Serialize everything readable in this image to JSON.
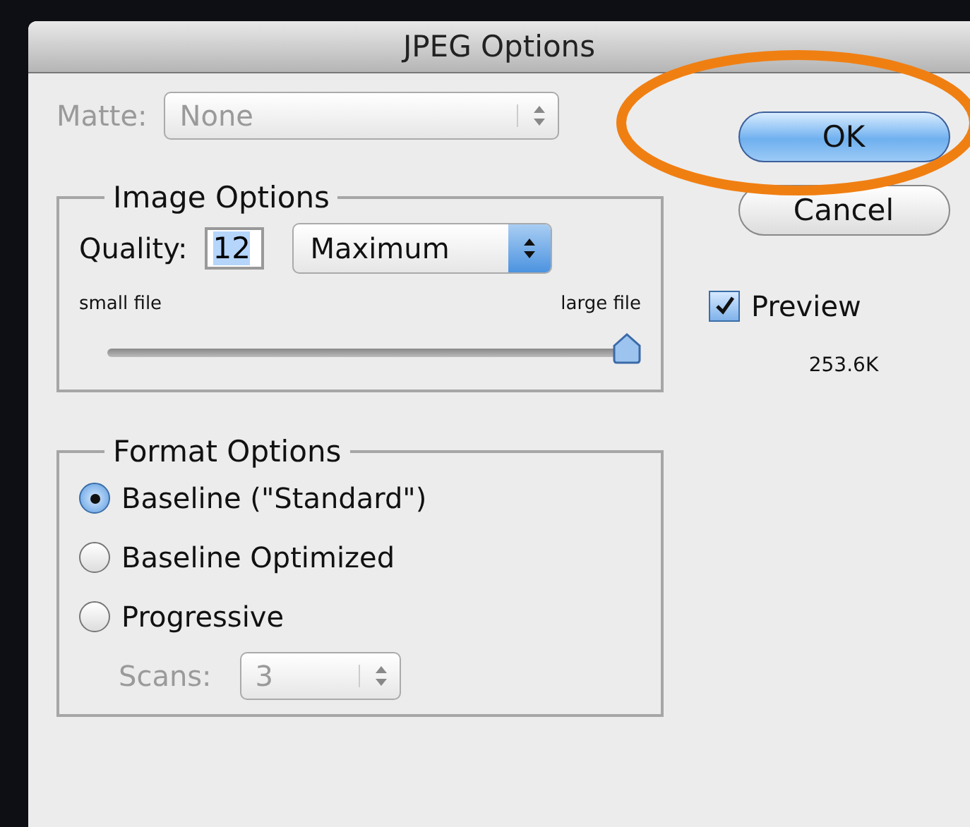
{
  "window": {
    "title": "JPEG Options"
  },
  "matte": {
    "label": "Matte:",
    "value": "None",
    "disabled": true
  },
  "buttons": [
    {
      "label": "OK",
      "default": true
    },
    {
      "label": "Cancel",
      "default": false
    }
  ],
  "preview": {
    "label": "Preview",
    "checked": true
  },
  "file_size": "253.6K",
  "image_options": {
    "title": "Image Options",
    "quality_label": "Quality:",
    "quality_value": "12",
    "quality_preset": "Maximum",
    "min_label": "small file",
    "max_label": "large file",
    "level": 1
  },
  "format_options": {
    "title": "Format Options",
    "choices": [
      {
        "label": "Baseline (\"Standard\")",
        "selected": true
      },
      {
        "label": "Baseline Optimized",
        "selected": false
      },
      {
        "label": "Progressive",
        "selected": false
      }
    ],
    "scans": {
      "label": "Scans:",
      "value": "3",
      "disabled": true
    }
  }
}
